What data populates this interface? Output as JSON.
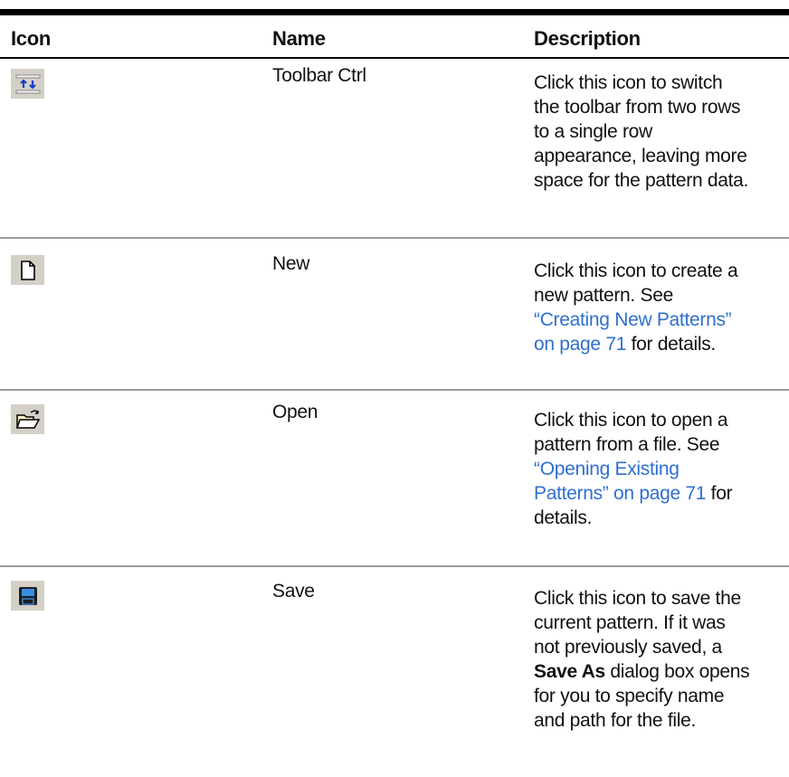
{
  "table": {
    "headers": {
      "icon": "Icon",
      "name": "Name",
      "description": "Description"
    },
    "rows": [
      {
        "icon": "toolbar-ctrl-icon",
        "name": "Toolbar Ctrl",
        "desc_lines": [
          "Click this icon to switch",
          "the toolbar from two rows",
          "to a single row",
          "appearance, leaving more",
          "space for the pattern data."
        ]
      },
      {
        "icon": "new-document-icon",
        "name": "New",
        "desc_lines": [
          "Click this icon to create a",
          "new pattern. See",
          "“Creating New Patterns”",
          "on page 71",
          " for details."
        ]
      },
      {
        "icon": "open-folder-icon",
        "name": "Open",
        "desc_lines": [
          "Click this icon to open a",
          "pattern from a file. See",
          "“Opening Existing",
          "Patterns” on page 71",
          " for",
          "details."
        ]
      },
      {
        "icon": "save-floppy-icon",
        "name": "Save",
        "desc_lines": [
          "Click this icon to save the",
          "current pattern. If it was",
          "not previously saved, a",
          "Save As",
          " dialog box opens",
          "for you to specify name",
          "and path for the file."
        ]
      }
    ]
  },
  "colors": {
    "link": "#2f6fcf",
    "icon_bg": "#d4d0c8",
    "rule": "#9a9a9a"
  }
}
